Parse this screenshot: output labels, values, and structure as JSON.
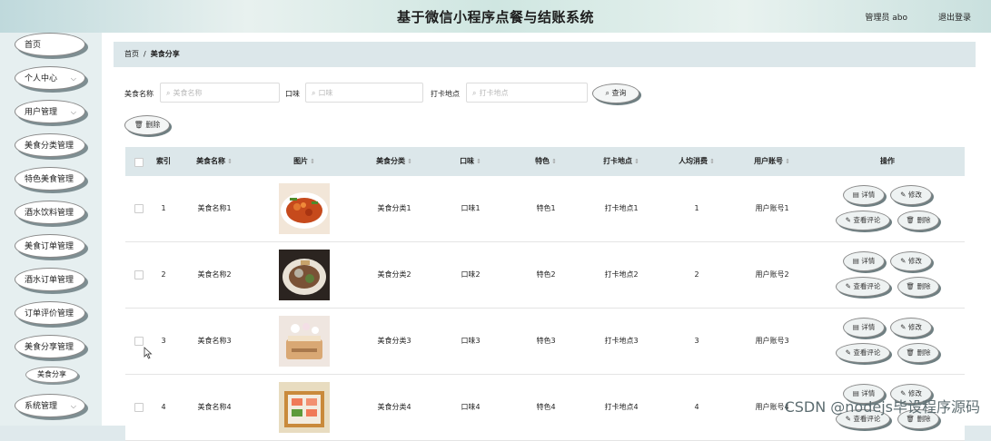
{
  "header": {
    "title": "基于微信小程序点餐与结账系统",
    "admin": "管理员 abo",
    "logout": "退出登录"
  },
  "sidebar": {
    "items": [
      {
        "label": "首页",
        "chevron": false
      },
      {
        "label": "个人中心",
        "chevron": true
      },
      {
        "label": "用户管理",
        "chevron": true
      },
      {
        "label": "美食分类管理",
        "chevron": false
      },
      {
        "label": "特色美食管理",
        "chevron": false
      },
      {
        "label": "酒水饮料管理",
        "chevron": false
      },
      {
        "label": "美食订单管理",
        "chevron": false
      },
      {
        "label": "酒水订单管理",
        "chevron": false
      },
      {
        "label": "订单评价管理",
        "chevron": false
      },
      {
        "label": "美食分享管理",
        "chevron": false
      }
    ],
    "sub_item": "美食分享",
    "last_item": {
      "label": "系统管理",
      "chevron": true
    }
  },
  "breadcrumb": {
    "home": "首页",
    "separator": "/",
    "current": "美食分享"
  },
  "search": {
    "name_label": "美食名称",
    "name_placeholder": "美食名称",
    "taste_label": "口味",
    "taste_placeholder": "口味",
    "location_label": "打卡地点",
    "location_placeholder": "打卡地点",
    "query_button": "查询",
    "delete_button": "删除"
  },
  "table": {
    "columns": [
      "索引",
      "美食名称",
      "图片",
      "美食分类",
      "口味",
      "特色",
      "打卡地点",
      "人均消费",
      "用户账号",
      "操作"
    ],
    "rows": [
      {
        "index": "1",
        "name": "美食名称1",
        "category": "美食分类1",
        "taste": "口味1",
        "feature": "特色1",
        "location": "打卡地点1",
        "avg": "1",
        "account": "用户账号1"
      },
      {
        "index": "2",
        "name": "美食名称2",
        "category": "美食分类2",
        "taste": "口味2",
        "feature": "特色2",
        "location": "打卡地点2",
        "avg": "2",
        "account": "用户账号2"
      },
      {
        "index": "3",
        "name": "美食名称3",
        "category": "美食分类3",
        "taste": "口味3",
        "feature": "特色3",
        "location": "打卡地点3",
        "avg": "3",
        "account": "用户账号3"
      },
      {
        "index": "4",
        "name": "美食名称4",
        "category": "美食分类4",
        "taste": "口味4",
        "feature": "特色4",
        "location": "打卡地点4",
        "avg": "4",
        "account": "用户账号4"
      }
    ],
    "actions": {
      "detail": "详情",
      "edit": "修改",
      "view_comments": "查看评论",
      "delete": "删除"
    }
  },
  "watermark": "CSDN @nodejs毕设程序源码",
  "colors": {
    "header_bg": "#cfe6e1",
    "breadcrumb_bg": "#dce7ea",
    "sidebar_bg": "#e6eff0"
  }
}
